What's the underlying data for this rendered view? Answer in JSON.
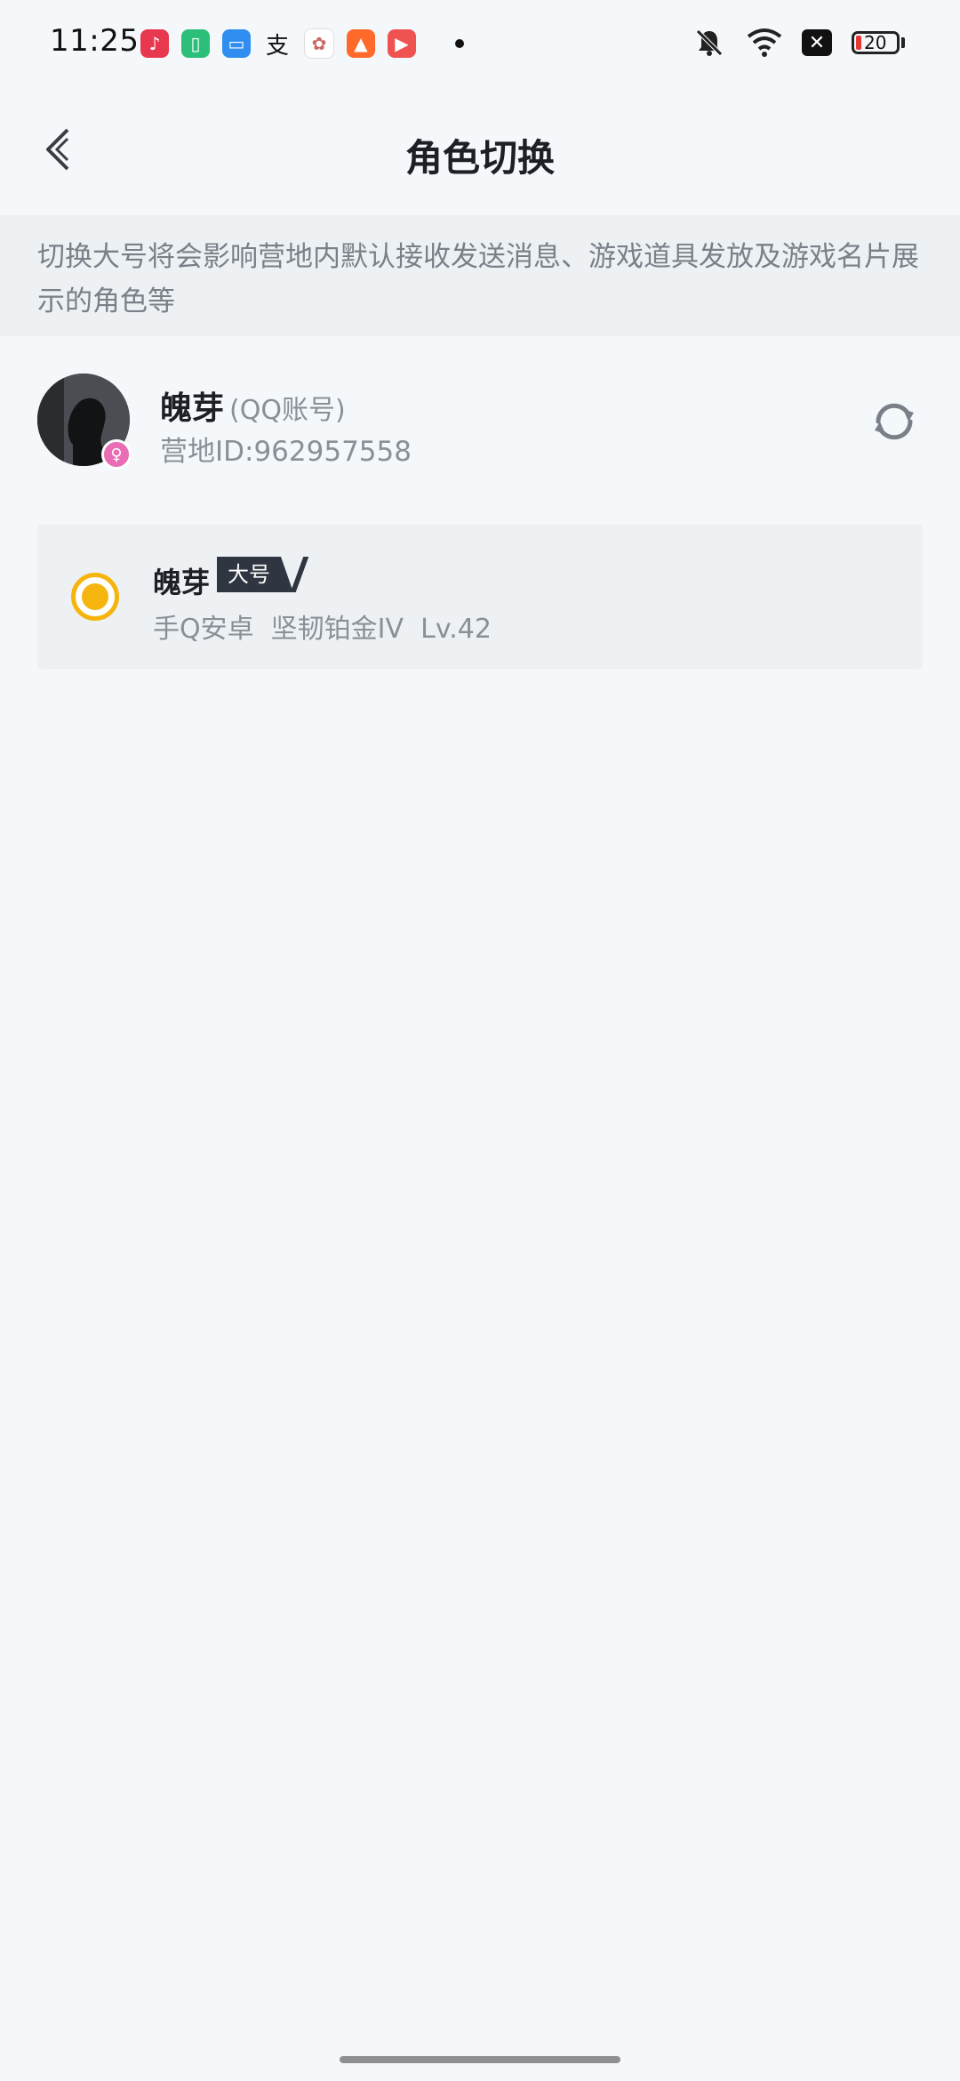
{
  "status_bar": {
    "time": "11:25",
    "battery_level": "20",
    "battery_color": "#e53935"
  },
  "header": {
    "title": "角色切换"
  },
  "notice": {
    "text": "切换大号将会影响营地内默认接收发送消息、游戏道具发放及游戏名片展示的角色等"
  },
  "account": {
    "name": "魄芽",
    "type": "(QQ账号)",
    "id_text": "营地ID:962957558"
  },
  "roles": [
    {
      "name": "魄芽",
      "tag": "大号",
      "info": "手Q安卓  坚韧铂金IV  Lv.42",
      "selected": true
    }
  ],
  "colors": {
    "accent": "#f5b50e",
    "background": "#f5f8fb",
    "tag_background": "#303641"
  }
}
